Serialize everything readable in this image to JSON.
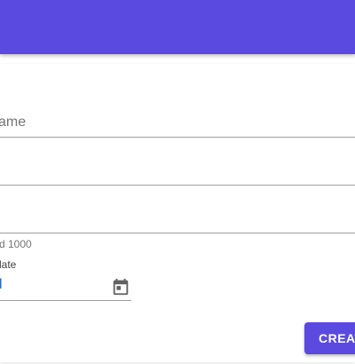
{
  "app_bar": {
    "color": "#5b4ae0"
  },
  "form": {
    "name_field_label": "ame",
    "helper_text": "d 1000",
    "date_label": "late",
    "date_value": "l",
    "date_picker_icon": "calendar-icon",
    "create_button_label": "CREAT"
  }
}
